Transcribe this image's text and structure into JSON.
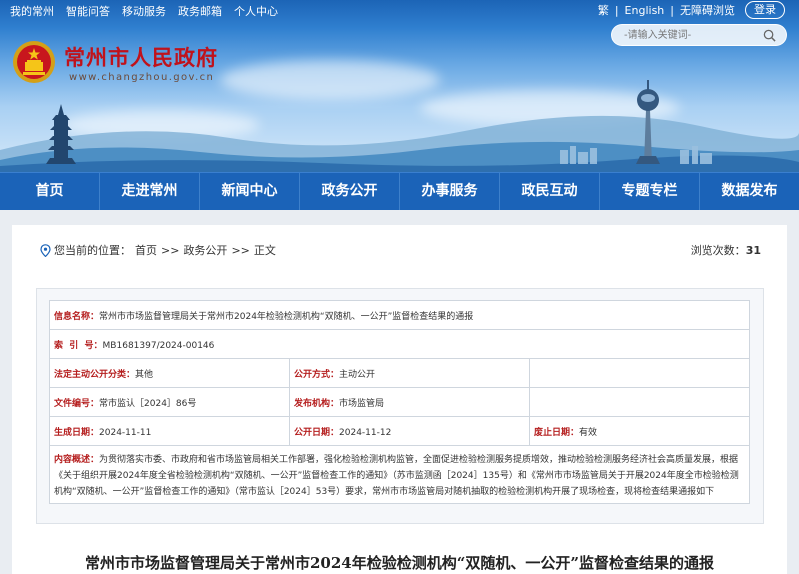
{
  "topbar": {
    "links": [
      "我的常州",
      "智能问答",
      "移动服务",
      "政务邮箱",
      "个人中心"
    ],
    "lang": [
      "繁",
      "English",
      "无障碍浏览"
    ],
    "login": "登录"
  },
  "site": {
    "name": "常州市人民政府",
    "url": "www.changzhou.gov.cn"
  },
  "search": {
    "placeholder": "-请输入关键词-"
  },
  "nav": [
    "首页",
    "走进常州",
    "新闻中心",
    "政务公开",
    "办事服务",
    "政民互动",
    "专题专栏",
    "数据发布"
  ],
  "breadcrumb": {
    "label": "您当前的位置：",
    "items": [
      "首页",
      ">>",
      "政务公开",
      ">>",
      "正文"
    ]
  },
  "views": {
    "label": "浏览次数：",
    "count": "31"
  },
  "meta": {
    "info_name_label": "信息名称：",
    "info_name": "常州市市场监督管理局关于常州市2024年检验检测机构“双随机、一公开”监督检查结果的通报",
    "index_label": "索  引  号：",
    "index": "MB1681397/2024-00146",
    "category_label": "法定主动公开分类：",
    "category": "其他",
    "method_label": "公开方式：",
    "method": "主动公开",
    "doc_no_label": "文件编号：",
    "doc_no": "常市监认［2024］86号",
    "publisher_label": "发布机构：",
    "publisher": "市场监管局",
    "created_label": "生成日期：",
    "created": "2024-11-11",
    "public_date_label": "公开日期：",
    "public_date": "2024-11-12",
    "expire_label": "废止日期：",
    "expire": "有效",
    "summary_label": "内容概述：",
    "summary": "为贯彻落实市委、市政府和省市场监管局相关工作部署，强化检验检测机构监管，全面促进检验检测服务提质增效，推动检验检测服务经济社会高质量发展，根据《关于组织开展2024年度全省检验检测机构“双随机、一公开”监督检查工作的通知》（苏市监测函［2024］135号）和《常州市市场监管局关于开展2024年度全市检验检测机构“双随机、一公开”监督检查工作的通知》（常市监认［2024］53号）要求，常州市市场监管局对随机抽取的检验检测机构开展了现场检查，现将检查结果通报如下"
  },
  "article": {
    "title": "常州市市场监督管理局关于常州市2024年检验检测机构“双随机、一公开”监督检查结果的通报"
  }
}
